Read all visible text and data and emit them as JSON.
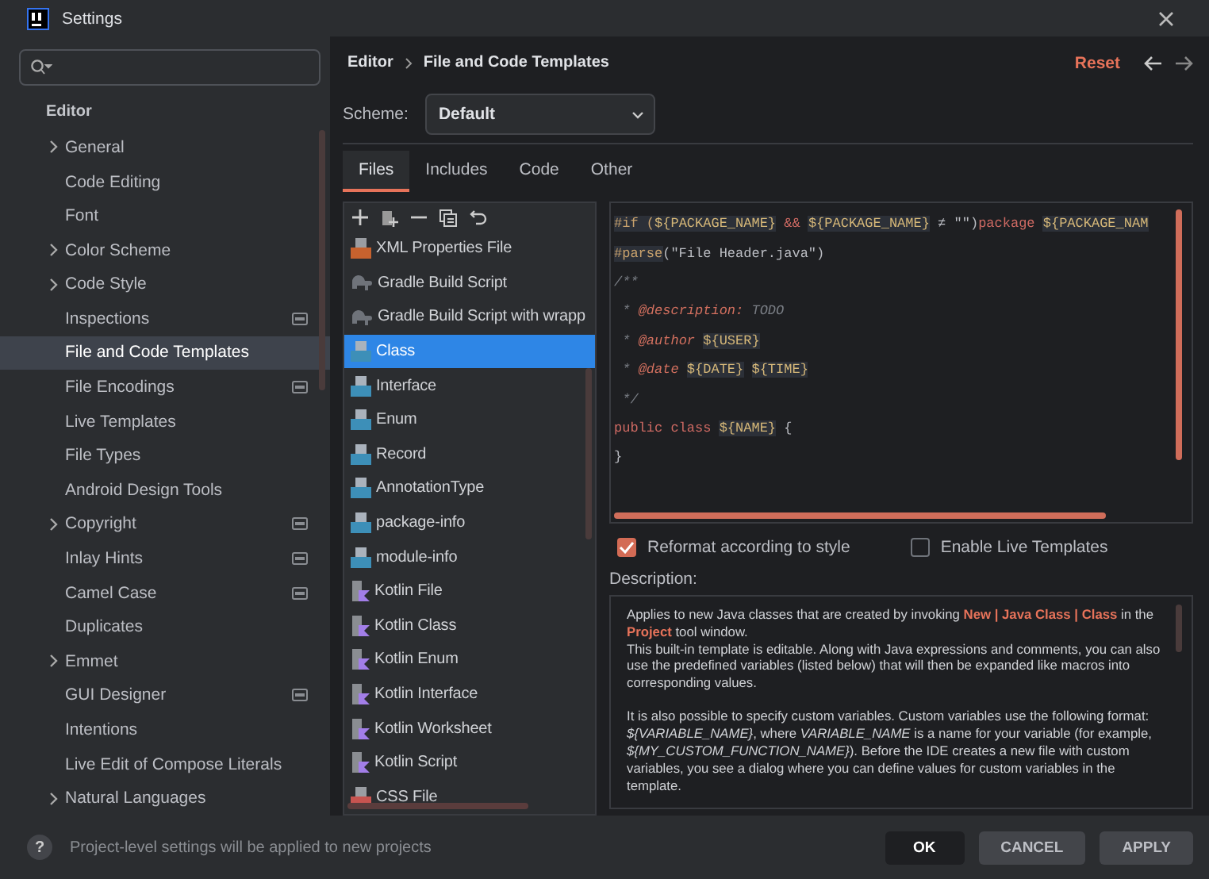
{
  "window": {
    "title": "Settings"
  },
  "sidebar": {
    "section": "Editor",
    "items": [
      {
        "label": "General",
        "expandable": true,
        "project_badge": false,
        "selected": false
      },
      {
        "label": "Code Editing",
        "expandable": false,
        "project_badge": false,
        "selected": false
      },
      {
        "label": "Font",
        "expandable": false,
        "project_badge": false,
        "selected": false
      },
      {
        "label": "Color Scheme",
        "expandable": true,
        "project_badge": false,
        "selected": false
      },
      {
        "label": "Code Style",
        "expandable": true,
        "project_badge": false,
        "selected": false
      },
      {
        "label": "Inspections",
        "expandable": false,
        "project_badge": true,
        "selected": false
      },
      {
        "label": "File and Code Templates",
        "expandable": false,
        "project_badge": false,
        "selected": true
      },
      {
        "label": "File Encodings",
        "expandable": false,
        "project_badge": true,
        "selected": false
      },
      {
        "label": "Live Templates",
        "expandable": false,
        "project_badge": false,
        "selected": false
      },
      {
        "label": "File Types",
        "expandable": false,
        "project_badge": false,
        "selected": false
      },
      {
        "label": "Android Design Tools",
        "expandable": false,
        "project_badge": false,
        "selected": false
      },
      {
        "label": "Copyright",
        "expandable": true,
        "project_badge": true,
        "selected": false
      },
      {
        "label": "Inlay Hints",
        "expandable": false,
        "project_badge": true,
        "selected": false
      },
      {
        "label": "Camel Case",
        "expandable": false,
        "project_badge": true,
        "selected": false
      },
      {
        "label": "Duplicates",
        "expandable": false,
        "project_badge": false,
        "selected": false
      },
      {
        "label": "Emmet",
        "expandable": true,
        "project_badge": false,
        "selected": false
      },
      {
        "label": "GUI Designer",
        "expandable": false,
        "project_badge": true,
        "selected": false
      },
      {
        "label": "Intentions",
        "expandable": false,
        "project_badge": false,
        "selected": false
      },
      {
        "label": "Live Edit of Compose Literals",
        "expandable": false,
        "project_badge": false,
        "selected": false
      },
      {
        "label": "Natural Languages",
        "expandable": true,
        "project_badge": false,
        "selected": false
      }
    ]
  },
  "header": {
    "breadcrumb": [
      "Editor",
      "File and Code Templates"
    ],
    "reset": "Reset"
  },
  "scheme": {
    "label": "Scheme:",
    "value": "Default"
  },
  "tabs": [
    {
      "label": "Files",
      "selected": true
    },
    {
      "label": "Includes",
      "selected": false
    },
    {
      "label": "Code",
      "selected": false
    },
    {
      "label": "Other",
      "selected": false
    }
  ],
  "templates": [
    {
      "label": "XML Properties File",
      "kind": "xml",
      "selected": false
    },
    {
      "label": "Gradle Build Script",
      "kind": "gradle",
      "selected": false
    },
    {
      "label": "Gradle Build Script with wrapp",
      "kind": "gradle",
      "selected": false
    },
    {
      "label": "Class",
      "kind": "java",
      "selected": true
    },
    {
      "label": "Interface",
      "kind": "java",
      "selected": false
    },
    {
      "label": "Enum",
      "kind": "java",
      "selected": false
    },
    {
      "label": "Record",
      "kind": "java",
      "selected": false
    },
    {
      "label": "AnnotationType",
      "kind": "java",
      "selected": false
    },
    {
      "label": "package-info",
      "kind": "java",
      "selected": false
    },
    {
      "label": "module-info",
      "kind": "java",
      "selected": false
    },
    {
      "label": "Kotlin File",
      "kind": "kotlin",
      "selected": false
    },
    {
      "label": "Kotlin Class",
      "kind": "kotlin",
      "selected": false
    },
    {
      "label": "Kotlin Enum",
      "kind": "kotlin",
      "selected": false
    },
    {
      "label": "Kotlin Interface",
      "kind": "kotlin",
      "selected": false
    },
    {
      "label": "Kotlin Worksheet",
      "kind": "kotlin",
      "selected": false
    },
    {
      "label": "Kotlin Script",
      "kind": "kotlin",
      "selected": false
    },
    {
      "label": "CSS File",
      "kind": "css",
      "selected": false
    }
  ],
  "code": [
    [
      {
        "kind": "directive",
        "text": "#if ("
      },
      {
        "kind": "var",
        "text": "${PACKAGE_NAME}"
      },
      {
        "kind": "keyword",
        "text": " && "
      },
      {
        "kind": "var",
        "text": "${PACKAGE_NAME}"
      },
      {
        "kind": "plain",
        "text": " ≠ \"\")"
      },
      {
        "kind": "keyword",
        "text": "package "
      },
      {
        "kind": "var",
        "text": "${PACKAGE_NAM"
      }
    ],
    [
      {
        "kind": "directive",
        "text": "#parse"
      },
      {
        "kind": "plain",
        "text": "(\"File Header.java\")"
      }
    ],
    [
      {
        "kind": "comment",
        "text": "/**"
      }
    ],
    [
      {
        "kind": "comment",
        "text": " * "
      },
      {
        "kind": "tag",
        "text": "@description:"
      },
      {
        "kind": "comment",
        "text": " TODO"
      }
    ],
    [
      {
        "kind": "comment",
        "text": " * "
      },
      {
        "kind": "tag",
        "text": "@author"
      },
      {
        "kind": "var",
        "text": "${USER}",
        "space_before": true
      }
    ],
    [
      {
        "kind": "comment",
        "text": " * "
      },
      {
        "kind": "tag",
        "text": "@date"
      },
      {
        "kind": "var",
        "text": "${DATE}",
        "space_before": true
      },
      {
        "kind": "var",
        "text": "${TIME}",
        "space_before": true
      }
    ],
    [
      {
        "kind": "comment",
        "text": " */"
      }
    ],
    [
      {
        "kind": "keyword",
        "text": "public class "
      },
      {
        "kind": "var",
        "text": "${NAME}"
      },
      {
        "kind": "plain",
        "text": " {"
      }
    ],
    [
      {
        "kind": "plain",
        "text": "}"
      }
    ]
  ],
  "options": [
    {
      "label": "Reformat according to style",
      "checked": true
    },
    {
      "label": "Enable Live Templates",
      "checked": false
    }
  ],
  "description": {
    "label": "Description:",
    "paragraphs": [
      "Applies to new Java classes that are created by invoking **New | Java Class | Class** in the **Project** tool window.\nThis built-in template is editable. Along with Java expressions and comments, you can also use the predefined variables (listed below) that will then be expanded like macros into corresponding values.",
      "It is also possible to specify custom variables. Custom variables use the following format: *${VARIABLE_NAME}*, where *VARIABLE_NAME* is a name for your variable (for example, *${MY_CUSTOM_FUNCTION_NAME}*). Before the IDE creates a new file with custom variables, you see a dialog where you can define values for custom variables in the template."
    ]
  },
  "footer": {
    "help": "?",
    "note": "Project-level settings will be applied to new projects",
    "buttons": [
      "OK",
      "CANCEL",
      "APPLY"
    ]
  }
}
